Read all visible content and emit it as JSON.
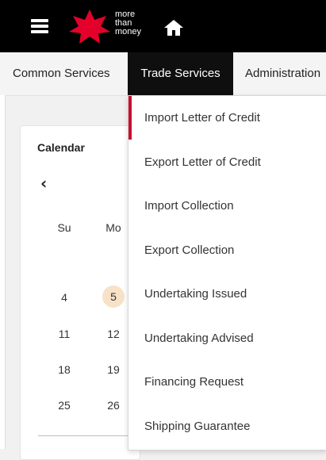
{
  "header": {
    "logo_text": [
      "more",
      "than",
      "money"
    ],
    "icons": {
      "menu": "hamburger-icon",
      "home": "home-icon",
      "logo": "star-logo"
    },
    "colors": {
      "bar": "#000000",
      "brand_red": "#e4002b"
    }
  },
  "nav": {
    "tabs": [
      {
        "label": "Common Services"
      },
      {
        "label": "Trade Services"
      },
      {
        "label": "Administration"
      }
    ],
    "active_tab": "Trade Services"
  },
  "calendar": {
    "title": "Calendar",
    "prev_label": "‹",
    "weekdays": [
      "Su",
      "Mo"
    ],
    "rows": [
      [
        "4",
        "5"
      ],
      [
        "11",
        "12"
      ],
      [
        "18",
        "19"
      ],
      [
        "25",
        "26"
      ]
    ],
    "highlighted_day": "5"
  },
  "dropdown": {
    "items": [
      {
        "label": "Import Letter of Credit"
      },
      {
        "label": "Export Letter of Credit"
      },
      {
        "label": "Import Collection"
      },
      {
        "label": "Export Collection"
      },
      {
        "label": "Undertaking Issued"
      },
      {
        "label": "Undertaking Advised"
      },
      {
        "label": "Financing Request"
      },
      {
        "label": "Shipping Guarantee"
      }
    ],
    "active_item": "Import Letter of Credit",
    "accent_color": "#c8102e"
  }
}
